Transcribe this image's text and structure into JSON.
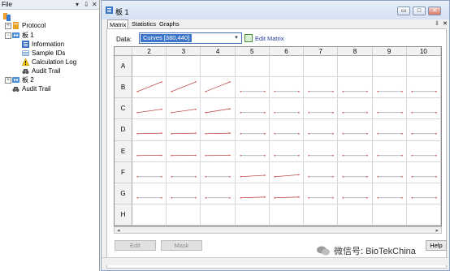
{
  "explorer": {
    "title": "File",
    "controls": [
      "▾",
      "⇩",
      "✕"
    ],
    "items": [
      {
        "label": "",
        "icon": "root-icon"
      },
      {
        "label": "Protocol",
        "icon": "protocol-icon"
      },
      {
        "label": "板 1",
        "icon": "plate-icon"
      },
      {
        "label": "Information",
        "icon": "information-icon"
      },
      {
        "label": "Sample IDs",
        "icon": "sample-ids-icon"
      },
      {
        "label": "Calculation Log",
        "icon": "warning-icon"
      },
      {
        "label": "Audit Trail",
        "icon": "audit-trail-icon"
      },
      {
        "label": "板 2",
        "icon": "plate-icon"
      },
      {
        "label": "Audit Trail",
        "icon": "audit-trail-icon"
      }
    ]
  },
  "window": {
    "title": "板 1",
    "controls": {
      "restore": "▭",
      "maximize": "□",
      "close": "✕"
    }
  },
  "tabs": [
    "Matrix",
    "Statistics",
    "Graphs"
  ],
  "pin": "⇩",
  "pin_close": "✕",
  "data_selector": {
    "label": "Data:",
    "value": "Curves [380,440]",
    "arrow": "▾"
  },
  "edit_matrix": "Edit Matrix",
  "plate": {
    "columns": [
      "2",
      "3",
      "4",
      "5",
      "6",
      "7",
      "8",
      "9",
      "10"
    ],
    "rows": [
      "A",
      "B",
      "C",
      "D",
      "E",
      "F",
      "G",
      "H"
    ],
    "curves": {
      "A": [
        null,
        null,
        null,
        null,
        null,
        null,
        null,
        null,
        null
      ],
      "B": [
        1.0,
        1.0,
        1.0,
        0.0,
        0.0,
        0.0,
        0.0,
        0.0,
        0.0
      ],
      "C": [
        0.35,
        0.35,
        0.4,
        0.0,
        0.0,
        0.0,
        0.0,
        0.0,
        0.0
      ],
      "D": [
        0.05,
        0.05,
        0.05,
        0.0,
        0.0,
        0.0,
        0.0,
        0.0,
        0.0
      ],
      "E": [
        0.02,
        0.02,
        0.02,
        0.0,
        0.0,
        0.0,
        0.0,
        0.0,
        0.0
      ],
      "F": [
        0.0,
        0.0,
        0.0,
        0.15,
        0.2,
        0.0,
        0.0,
        0.0,
        0.0
      ],
      "G": [
        0.0,
        0.0,
        0.0,
        0.08,
        0.08,
        0.0,
        0.0,
        0.0,
        0.0
      ],
      "H": [
        null,
        null,
        null,
        null,
        null,
        null,
        null,
        null,
        null
      ]
    },
    "curve_color": "#c0504d",
    "flat_color": "#d9534f"
  },
  "buttons": {
    "edit": "Edit",
    "mask": "Mask",
    "help": "Help"
  },
  "watermark": "微信号: BioTekChina"
}
